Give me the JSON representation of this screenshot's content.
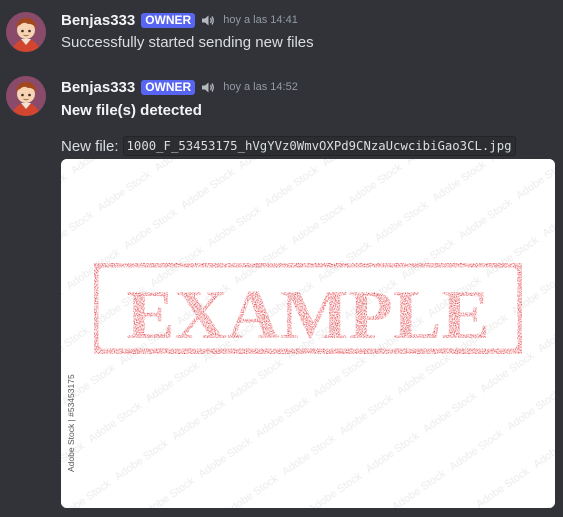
{
  "messages": [
    {
      "username": "Benjas333",
      "role": "OWNER",
      "timestamp": "hoy a las 14:41",
      "text": "Successfully started sending new files"
    },
    {
      "username": "Benjas333",
      "role": "OWNER",
      "timestamp": "hoy a las 14:52",
      "text": "New file(s) detected",
      "file_label": "New file:",
      "file_name": "1000_F_53453175_hVgYVz0WmvOXPd9CNzaUcwcibiGao3CL.jpg",
      "image": {
        "stamp_text": "EXAMPLE",
        "side_caption": "Adobe Stock | #53453175",
        "stamp_color": "#e0242a"
      }
    }
  ],
  "colors": {
    "background": "#313338",
    "badge": "#5865f2",
    "username": "#f2f3f5",
    "timestamp": "#949ba4"
  },
  "icons": [
    "speaker-icon",
    "avatar"
  ]
}
